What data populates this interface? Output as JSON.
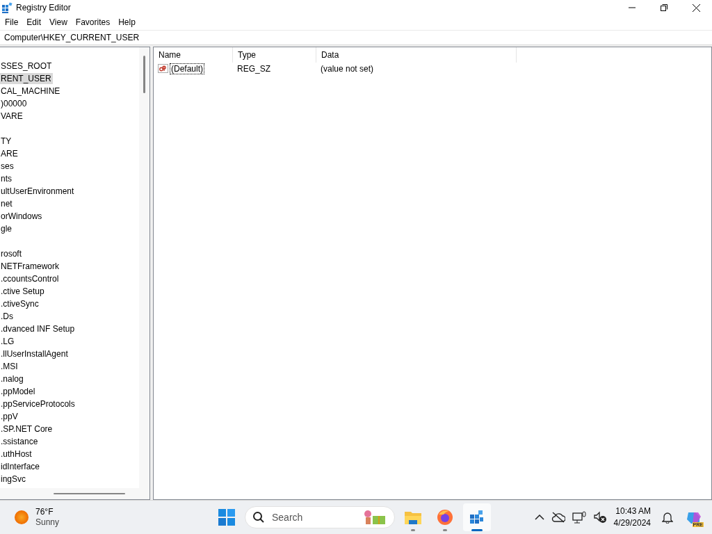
{
  "window": {
    "title": "Registry Editor"
  },
  "menu": [
    "File",
    "Edit",
    "View",
    "Favorites",
    "Help"
  ],
  "address": "Computer\\HKEY_CURRENT_USER",
  "tree": [
    {
      "kind": "key",
      "text": "SSES_ROOT",
      "selected": false
    },
    {
      "kind": "key",
      "text": "RENT_USER",
      "selected": true
    },
    {
      "kind": "key",
      "text": "CAL_MACHINE",
      "selected": false
    },
    {
      "kind": "key",
      "text": ")00000",
      "selected": false
    },
    {
      "kind": "key",
      "text": "VARE",
      "selected": false
    },
    {
      "kind": "blank"
    },
    {
      "kind": "key",
      "text": "TY",
      "selected": false
    },
    {
      "kind": "key",
      "text": "ARE",
      "selected": false
    },
    {
      "kind": "key",
      "text": "ses",
      "selected": false
    },
    {
      "kind": "key",
      "text": "nts",
      "selected": false
    },
    {
      "kind": "key",
      "text": "ultUserEnvironment",
      "selected": false
    },
    {
      "kind": "key",
      "text": "net",
      "selected": false
    },
    {
      "kind": "key",
      "text": "orWindows",
      "selected": false
    },
    {
      "kind": "key",
      "text": "gle",
      "selected": false
    },
    {
      "kind": "blank"
    },
    {
      "kind": "key",
      "text": "rosoft",
      "selected": false
    },
    {
      "kind": "key",
      "text": "NETFramework",
      "selected": false
    },
    {
      "kind": "key",
      "text": ".ccountsControl",
      "selected": false
    },
    {
      "kind": "key",
      "text": ".ctive Setup",
      "selected": false
    },
    {
      "kind": "key",
      "text": ".ctiveSync",
      "selected": false
    },
    {
      "kind": "key",
      "text": ".Ds",
      "selected": false
    },
    {
      "kind": "key",
      "text": ".dvanced INF Setup",
      "selected": false
    },
    {
      "kind": "key",
      "text": ".LG",
      "selected": false
    },
    {
      "kind": "key",
      "text": ".llUserInstallAgent",
      "selected": false
    },
    {
      "kind": "key",
      "text": ".MSI",
      "selected": false
    },
    {
      "kind": "key",
      "text": ".nalog",
      "selected": false
    },
    {
      "kind": "key",
      "text": ".ppModel",
      "selected": false
    },
    {
      "kind": "key",
      "text": ".ppServiceProtocols",
      "selected": false
    },
    {
      "kind": "key",
      "text": ".ppV",
      "selected": false
    },
    {
      "kind": "key",
      "text": ".SP.NET Core",
      "selected": false
    },
    {
      "kind": "key",
      "text": ".ssistance",
      "selected": false
    },
    {
      "kind": "key",
      "text": ".uthHost",
      "selected": false
    },
    {
      "kind": "key",
      "text": "idInterface",
      "selected": false
    },
    {
      "kind": "key",
      "text": "ingSvc",
      "selected": false
    }
  ],
  "table": {
    "columns": [
      "Name",
      "Type",
      "Data"
    ],
    "rows": [
      {
        "name": "(Default)",
        "type": "REG_SZ",
        "data": "(value not set)",
        "focused": true
      }
    ]
  },
  "taskbar": {
    "weather": {
      "temp": "76°F",
      "condition": "Sunny"
    },
    "search": {
      "placeholder": "Search"
    },
    "clock": {
      "time": "10:43 AM",
      "date": "4/29/2024"
    },
    "copilot_badge": "PRE"
  }
}
